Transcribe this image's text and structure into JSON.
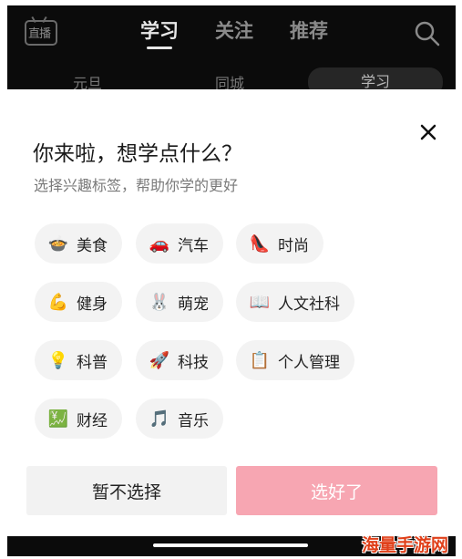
{
  "topbar": {
    "live_label": "直播",
    "tabs": [
      {
        "label": "学习",
        "active": true
      },
      {
        "label": "关注",
        "active": false
      },
      {
        "label": "推荐",
        "active": false
      }
    ],
    "chips": [
      {
        "label": "元旦",
        "active": false
      },
      {
        "label": "同城",
        "active": false
      },
      {
        "label": "学习",
        "active": true
      }
    ]
  },
  "sheet": {
    "title": "你来啦，想学点什么？",
    "subtitle": "选择兴趣标签，帮助你学的更好",
    "tags": [
      {
        "icon": "food-icon",
        "emoji": "🍲",
        "label": "美食"
      },
      {
        "icon": "car-icon",
        "emoji": "🚗",
        "label": "汽车"
      },
      {
        "icon": "high-heel-icon",
        "emoji": "👠",
        "label": "时尚"
      },
      {
        "icon": "flexed-biceps-icon",
        "emoji": "💪",
        "label": "健身"
      },
      {
        "icon": "rabbit-icon",
        "emoji": "🐰",
        "label": "萌宠"
      },
      {
        "icon": "open-book-icon",
        "emoji": "📖",
        "label": "人文社科"
      },
      {
        "icon": "light-bulb-icon",
        "emoji": "💡",
        "label": "科普"
      },
      {
        "icon": "rocket-icon",
        "emoji": "🚀",
        "label": "科技"
      },
      {
        "icon": "clipboard-icon",
        "emoji": "📋",
        "label": "个人管理"
      },
      {
        "icon": "chart-icon",
        "emoji": "💹",
        "label": "财经"
      },
      {
        "icon": "music-note-icon",
        "emoji": "🎵",
        "label": "音乐"
      }
    ],
    "skip_label": "暂不选择",
    "done_label": "选好了"
  },
  "watermark": "海量手游网",
  "colors": {
    "accent_pink": "#f7a6b2",
    "topbar_bg": "#0b0b0b",
    "watermark_red": "#e0401a"
  }
}
